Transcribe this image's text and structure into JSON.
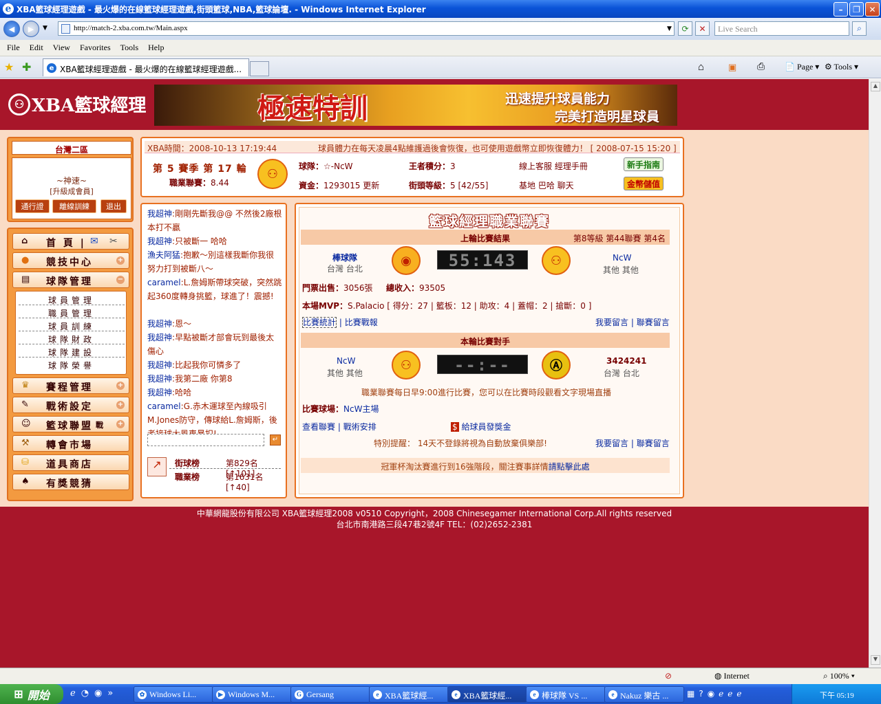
{
  "window": {
    "title": "XBA籃球經理遊戲 - 最火爆的在線籃球經理遊戲,街頭籃球,NBA,籃球論壇. - Windows Internet Explorer"
  },
  "address": {
    "url": "http://match-2.xba.com.tw/Main.aspx",
    "search_placeholder": "Live Search"
  },
  "menu": [
    "File",
    "Edit",
    "View",
    "Favorites",
    "Tools",
    "Help"
  ],
  "tab": {
    "title": "XBA籃球經理遊戲 - 最火爆的在線籃球經理遊戲..."
  },
  "toolbar_right": {
    "page": "Page",
    "tools": "Tools"
  },
  "site": {
    "logo": "XBA籃球經理",
    "banner": {
      "main": "極速特訓",
      "line1": "迅速提升球員能力",
      "line2": "完美打造明星球員"
    },
    "server": "台灣二區",
    "user": {
      "name": "~神速~",
      "rank": "[升級成會員]",
      "btn1": "通行證",
      "btn2": "離線訓練",
      "btn3": "退出"
    },
    "menu": [
      {
        "label": "首 頁 |",
        "icon": "house-icon"
      },
      {
        "label": "競技中心",
        "icon": "basketball-icon"
      },
      {
        "label": "球隊管理",
        "icon": "clipboard-icon"
      },
      {
        "label": "賽程管理",
        "icon": "trophy-icon"
      },
      {
        "label": "戰術設定",
        "icon": "tactics-icon"
      },
      {
        "label": "籃球聯盟",
        "icon": "people-icon",
        "extra": "戰"
      },
      {
        "label": "轉會市場",
        "icon": "gavel-icon"
      },
      {
        "label": "道具商店",
        "icon": "coins-icon"
      },
      {
        "label": "有獎競猜",
        "icon": "spade-icon"
      }
    ],
    "submenu": [
      "球員管理",
      "職員管理",
      "球員訓練",
      "球隊財政",
      "球隊建設",
      "球隊榮譽"
    ],
    "info": {
      "time": "XBA時間：2008-10-13 17:19:44",
      "notice": "球員體力在每天凌晨4點維護過後會恢復，也可使用遊戲幣立即恢復體力！ [ 2008-07-15 15:20 ]",
      "season": "第 5 賽季 第 17 輪",
      "league_label": "職業聯賽：",
      "league_val": "8.44",
      "team_label": "球隊：",
      "team_val": "☆-NcW",
      "points_label": "王者積分：",
      "points_val": "3",
      "support": "線上客服 經理手冊",
      "money_label": "資金：",
      "money_val": "1293015",
      "update": "更新",
      "level_label": "街頭等級：",
      "level_val": "5 [42/55]",
      "links": "基地 巴哈 聊天",
      "guide_btn": "新手指南",
      "coin_btn": "金幣儲值"
    },
    "chat": [
      {
        "name": "我超神",
        "text": "剛剛先斷我@@ 不然後2廠根本打不贏"
      },
      {
        "name": "我超神",
        "text": "只被斷一 哈哈"
      },
      {
        "name": "漁夫阿猛",
        "text": "抱歉～別這樣我斷你我很努力打到被斷八～"
      },
      {
        "name": "caramel",
        "text": "L.詹姆斯帶球突破，突然跳起360度轉身挑籃，球進了！震撼!"
      },
      {
        "name": "我超神",
        "text": "恩～"
      },
      {
        "name": "我超神",
        "text": "早點被斷才部會玩到最後太傷心"
      },
      {
        "name": "我超神",
        "text": "比起我你可憐多了"
      },
      {
        "name": "我超神",
        "text": "我第二廠 你第8"
      },
      {
        "name": "我超神",
        "text": "哈哈"
      },
      {
        "name": "caramel",
        "text": "G.赤木運球至內線吸引M.Jones防守，傳球給L.詹姆斯，後者接球大風車暴扣!"
      }
    ],
    "rank": {
      "street_label": "街球榜",
      "street_val": "第829名[↑101]",
      "pro_label": "職業榜",
      "pro_val": "第1631名[↑40]"
    },
    "league": {
      "title": "籃球經理職業聯賽",
      "last_header": "上輪比賽結果",
      "last_info": "第8等級 第44聯賽 第4名",
      "home_team": "棒球隊",
      "home_loc": "台灣 台北",
      "score": "55:143",
      "away_team": "NcW",
      "away_loc": "其他 其他",
      "ticket_label": "門票出售：",
      "ticket_val": "3056張",
      "income_label": "總收入：",
      "income_val": "93505",
      "mvp_label": "本場MVP：",
      "mvp_val": "S.Palacio [ 得分：27 | 籃板：12 | 助攻：4 | 蓋帽：2 | 搶斷：0 ]",
      "stats_link": "比賽統計",
      "report_link": "比賽戰報",
      "comment1": "我要留言",
      "comment2": "聯賽留言",
      "next_header": "本輪比賽對手",
      "next_home": "NcW",
      "next_home_loc": "其他 其他",
      "next_score": "--:--",
      "next_away": "3424241",
      "next_away_loc": "台灣 台北",
      "schedule_note": "職業聯賽每日早9:00進行比賽，您可以在比賽時段觀看文字現場直播",
      "venue_label": "比賽球場：",
      "venue_val": "NcW主場",
      "view_league": "查看聯賽",
      "tactics": "戰術安排",
      "bonus": "給球員發獎金",
      "warning": "特別提醒： 14天不登錄將視為自動放棄俱樂部!",
      "cup_note": "冠軍杯淘汰賽進行到16強階段，關注賽事詳情",
      "cup_link": "請點擊此處"
    },
    "footer": {
      "line1": "中華網龍股份有限公司 XBA籃球經理2008 v0510 Copyright，2008 Chinesegamer International Corp.All rights reserved",
      "line2": "台北市南港路三段47巷2號4F TEL：(02)2652-2381"
    }
  },
  "status": {
    "zone": "Internet",
    "zoom": "100%"
  },
  "taskbar": {
    "start": "開始",
    "tasks": [
      "Windows Li...",
      "Windows M...",
      "Gersang",
      "XBA籃球經...",
      "XBA籃球經...",
      "棒球隊 VS ...",
      "Nakuz 樂古 ..."
    ],
    "clock": "下午 05:19"
  }
}
